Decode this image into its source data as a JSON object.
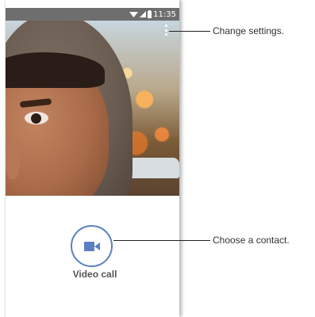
{
  "status_bar": {
    "time": "11:35",
    "icons": [
      "wifi-icon",
      "signal-icon",
      "battery-icon"
    ]
  },
  "menu": {
    "icon": "more-vert-icon"
  },
  "video_call": {
    "label": "Video call",
    "icon": "videocam-icon",
    "accent_color": "#5a80c2"
  },
  "callouts": {
    "settings": "Change settings.",
    "contact": "Choose a contact."
  }
}
